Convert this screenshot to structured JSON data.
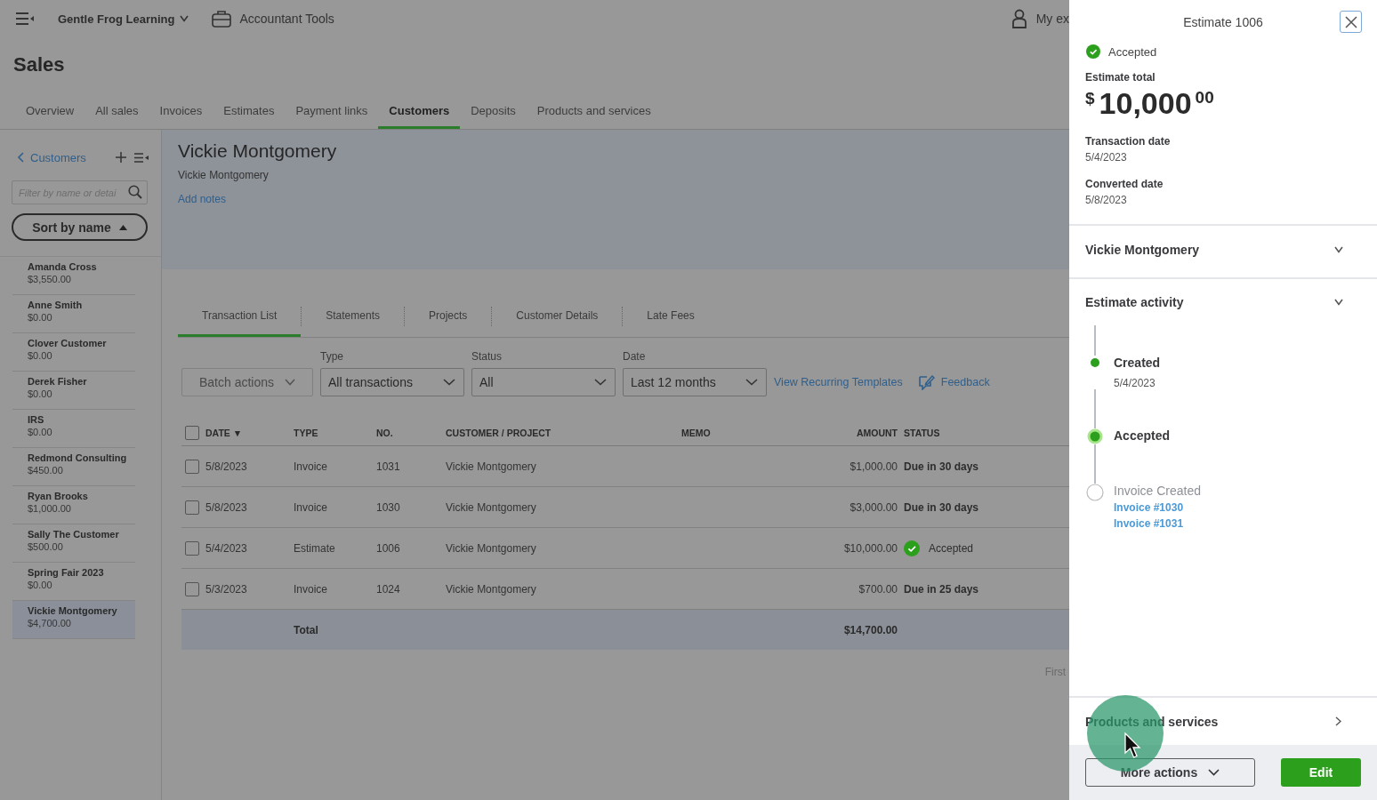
{
  "topbar": {
    "company": "Gentle Frog Learning",
    "tools": "Accountant Tools",
    "user": "My ex"
  },
  "page_title": "Sales",
  "tabs": [
    {
      "label": "Overview",
      "selected": false
    },
    {
      "label": "All sales",
      "selected": false
    },
    {
      "label": "Invoices",
      "selected": false
    },
    {
      "label": "Estimates",
      "selected": false
    },
    {
      "label": "Payment links",
      "selected": false
    },
    {
      "label": "Customers",
      "selected": true
    },
    {
      "label": "Deposits",
      "selected": false
    },
    {
      "label": "Products and services",
      "selected": false
    }
  ],
  "sidebar": {
    "back_link": "Customers",
    "filter_placeholder": "Filter by name or detai",
    "sort": "Sort by name",
    "customers": [
      {
        "name": "Amanda Cross",
        "balance": "$3,550.00",
        "selected": false
      },
      {
        "name": "Anne Smith",
        "balance": "$0.00",
        "selected": false
      },
      {
        "name": "Clover Customer",
        "balance": "$0.00",
        "selected": false
      },
      {
        "name": "Derek Fisher",
        "balance": "$0.00",
        "selected": false
      },
      {
        "name": "IRS",
        "balance": "$0.00",
        "selected": false
      },
      {
        "name": "Redmond Consulting",
        "balance": "$450.00",
        "selected": false
      },
      {
        "name": "Ryan Brooks",
        "balance": "$1,000.00",
        "selected": false
      },
      {
        "name": "Sally The Customer",
        "balance": "$500.00",
        "selected": false
      },
      {
        "name": "Spring Fair 2023",
        "balance": "$0.00",
        "selected": false
      },
      {
        "name": "Vickie Montgomery",
        "balance": "$4,700.00",
        "selected": true
      }
    ]
  },
  "customer": {
    "name": "Vickie Montgomery",
    "subtitle": "Vickie Montgomery",
    "add_notes": "Add notes"
  },
  "subtabs": [
    {
      "label": "Transaction List",
      "selected": true
    },
    {
      "label": "Statements",
      "selected": false
    },
    {
      "label": "Projects",
      "selected": false
    },
    {
      "label": "Customer Details",
      "selected": false
    },
    {
      "label": "Late Fees",
      "selected": false
    }
  ],
  "filters": {
    "batch": "Batch actions",
    "selects": [
      {
        "label": "Type",
        "value": "All transactions"
      },
      {
        "label": "Status",
        "value": "All"
      },
      {
        "label": "Date",
        "value": "Last 12 months"
      }
    ],
    "recurring_link": "View Recurring Templates",
    "feedback": "Feedback"
  },
  "table": {
    "header_checked": false,
    "columns": [
      "DATE ▼",
      "TYPE",
      "NO.",
      "CUSTOMER / PROJECT",
      "MEMO",
      "AMOUNT",
      "STATUS"
    ],
    "rows": [
      {
        "checked": false,
        "date": "5/8/2023",
        "type": "Invoice",
        "no": "1031",
        "customer": "Vickie Montgomery",
        "amount": "$1,000.00",
        "status": "Due in 30 days",
        "kind": "text"
      },
      {
        "checked": false,
        "date": "5/8/2023",
        "type": "Invoice",
        "no": "1030",
        "customer": "Vickie Montgomery",
        "amount": "$3,000.00",
        "status": "Due in 30 days",
        "kind": "text"
      },
      {
        "checked": false,
        "date": "5/4/2023",
        "type": "Estimate",
        "no": "1006",
        "customer": "Vickie Montgomery",
        "amount": "$10,000.00",
        "status": "Accepted",
        "kind": "accepted"
      },
      {
        "checked": false,
        "date": "5/3/2023",
        "type": "Invoice",
        "no": "1024",
        "customer": "Vickie Montgomery",
        "amount": "$700.00",
        "status": "Due in 25 days",
        "kind": "text"
      }
    ],
    "total": {
      "label": "Total",
      "amount": "$14,700.00"
    }
  },
  "pagination": "First",
  "panel": {
    "title": "Estimate 1006",
    "status": "Accepted",
    "total_label": "Estimate total",
    "currency": "$",
    "total_whole": "10,000",
    "total_cents": "00",
    "fields": [
      {
        "label": "Transaction date",
        "value": "5/4/2023"
      },
      {
        "label": "Converted date",
        "value": "5/8/2023"
      }
    ],
    "customer_section": "Vickie Montgomery",
    "activity_title": "Estimate activity",
    "events": [
      {
        "label": "Created",
        "kind": "done",
        "date": "5/4/2023"
      },
      {
        "label": "Accepted",
        "kind": "current"
      },
      {
        "label": "Invoice Created",
        "kind": "pending",
        "links": [
          "Invoice #1030",
          "Invoice #1031"
        ]
      }
    ],
    "products_title": "Products and services",
    "more_actions": "More actions",
    "edit": "Edit"
  }
}
